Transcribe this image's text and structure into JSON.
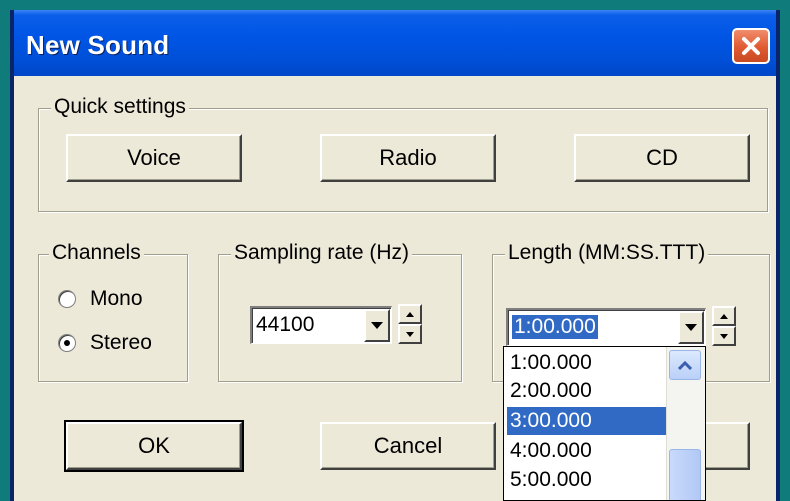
{
  "window": {
    "title": "New Sound",
    "close_icon": "close-x-icon"
  },
  "quick_settings": {
    "label": "Quick settings",
    "buttons": [
      "Voice",
      "Radio",
      "CD"
    ]
  },
  "channels": {
    "label": "Channels",
    "options": [
      {
        "label": "Mono",
        "selected": false
      },
      {
        "label": "Stereo",
        "selected": true
      }
    ]
  },
  "sampling_rate": {
    "label": "Sampling rate (Hz)",
    "value": "44100"
  },
  "length": {
    "label": "Length (MM:SS.TTT)",
    "value": "1:00.000",
    "options": [
      "1:00.000",
      "2:00.000",
      "3:00.000",
      "4:00.000",
      "5:00.000"
    ],
    "highlighted": "3:00.000"
  },
  "footer": {
    "ok_label": "OK",
    "cancel_label": "Cancel"
  },
  "colors": {
    "desktop": "#0f7b7b",
    "titlebar": "#0055e5",
    "dialog_face": "#ece9d8",
    "selection": "#316ac5",
    "close_button": "#e05a31"
  }
}
